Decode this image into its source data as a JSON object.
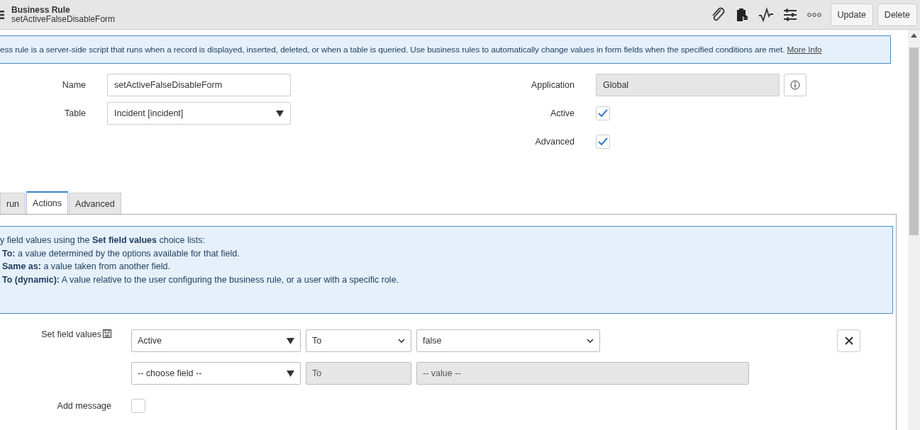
{
  "header": {
    "title": "Business Rule",
    "subtitle": "setActiveFalseDisableForm",
    "buttons": [
      "Update",
      "Delete"
    ]
  },
  "intro": {
    "text": "ess rule is a server-side script that runs when a record is displayed, inserted, deleted, or when a table is queried. Use business rules to automatically change values in form fields when the specified conditions are met.",
    "link": "More Info"
  },
  "fields_left": [
    {
      "label": "Name",
      "kind": "text",
      "value": "setActiveFalseDisableForm"
    },
    {
      "label": "Table",
      "kind": "select",
      "value": "Incident [incident]"
    }
  ],
  "fields_right": [
    {
      "label": "Application",
      "kind": "readonly",
      "value": "Global"
    },
    {
      "label": "Active",
      "kind": "checkbox",
      "checked": true
    },
    {
      "label": "Advanced",
      "kind": "checkbox",
      "checked": true
    }
  ],
  "tabs": [
    {
      "label": "run",
      "selected": false
    },
    {
      "label": "Actions",
      "selected": true
    },
    {
      "label": "Advanced",
      "selected": false
    }
  ],
  "help": {
    "lines": [
      "y field values using the **Set field values** choice lists:",
      "**To:** a value determined by the options available for that field.",
      "**Same as:** a value taken from another field.",
      "**To (dynamic):** A value relative to the user configuring the business rule, or a user with a specific role."
    ]
  },
  "set_field_values": {
    "label": "Set field values",
    "rows": [
      {
        "field": "Active",
        "operator": "To",
        "value": "false",
        "disabled": false
      },
      {
        "field": "-- choose field --",
        "operator": "To",
        "value": "-- value --",
        "disabled": true
      }
    ]
  },
  "add_message": {
    "label": "Add message",
    "checked": false
  }
}
